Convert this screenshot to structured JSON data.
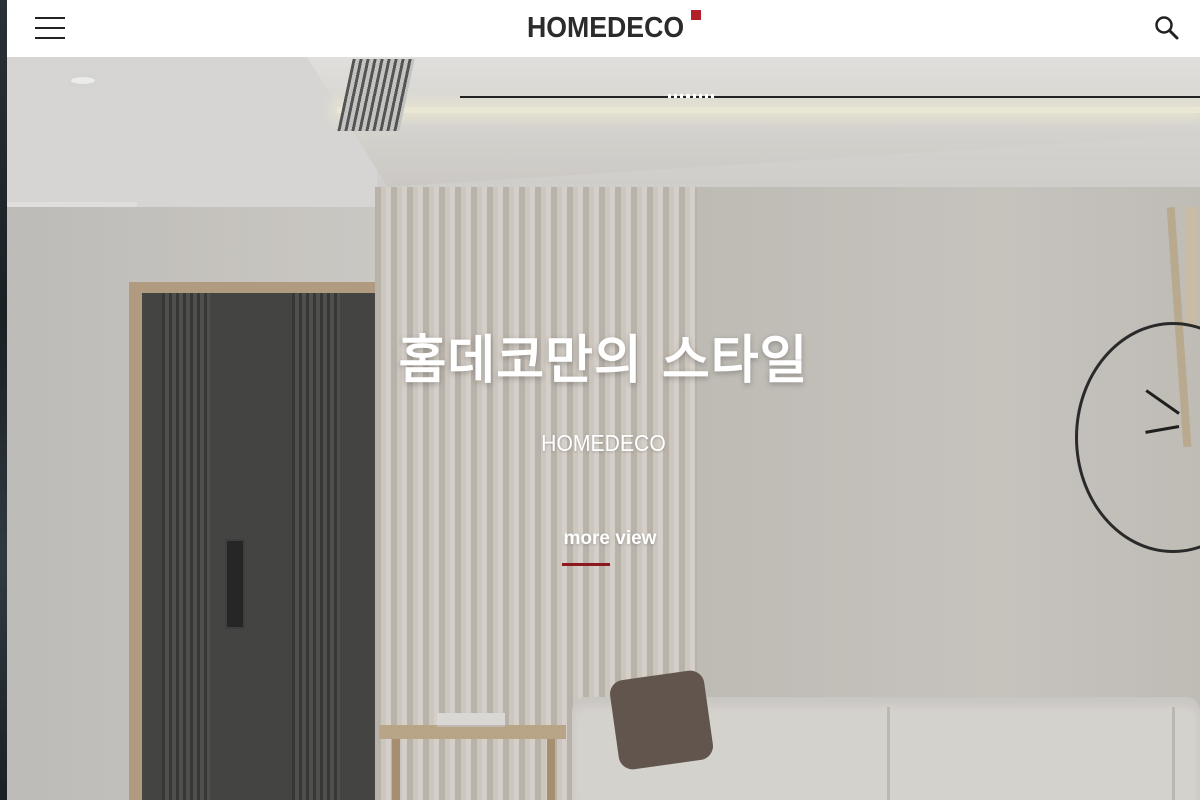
{
  "header": {
    "logo_text": "HOMEDECO",
    "menu_icon": "hamburger-menu-icon",
    "search_icon": "search-icon",
    "logo_accent_color": "#b3202a"
  },
  "hero": {
    "title": "홈데코만의 스타일",
    "subtitle": "HOMEDECO",
    "cta_label": "more view",
    "cta_underline_color": "#8e1a1f",
    "slide_indicator_count": 1
  }
}
